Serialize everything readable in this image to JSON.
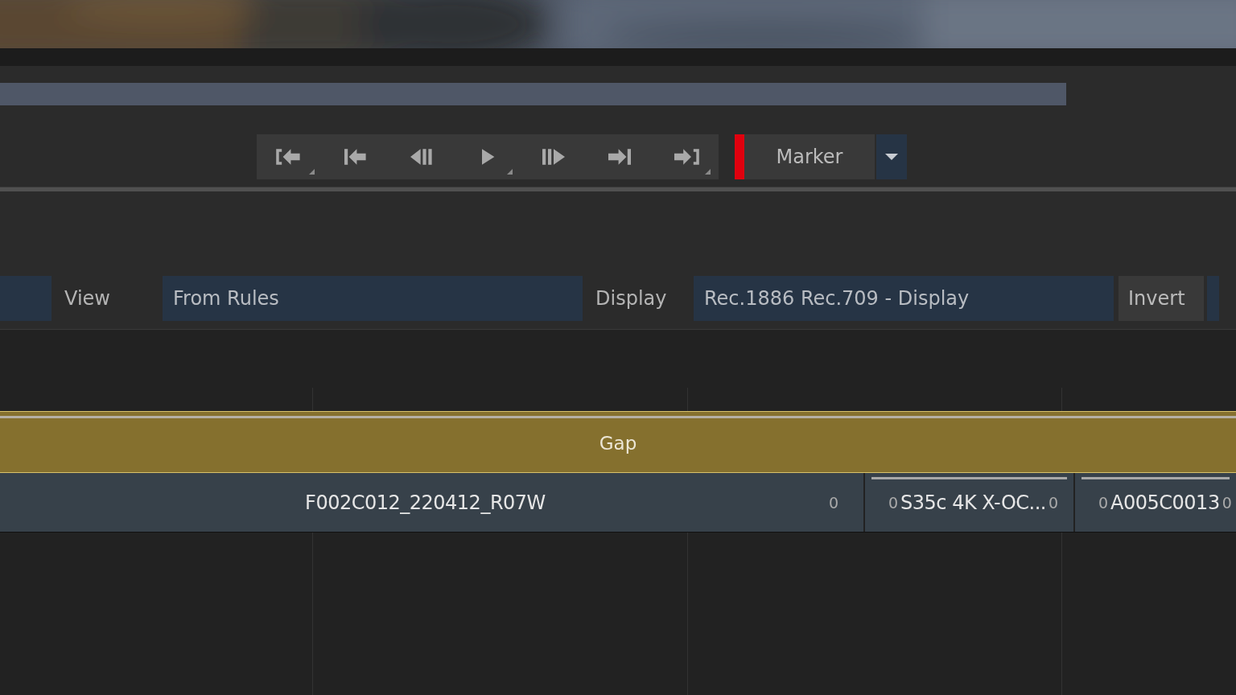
{
  "transport": {
    "buttons": [
      {
        "kind": "in-point",
        "has_menu": true
      },
      {
        "kind": "previous-edit",
        "has_menu": false
      },
      {
        "kind": "step-back",
        "has_menu": false
      },
      {
        "kind": "play",
        "has_menu": true
      },
      {
        "kind": "step-forward",
        "has_menu": false
      },
      {
        "kind": "next-edit",
        "has_menu": false
      },
      {
        "kind": "out-point",
        "has_menu": true
      }
    ]
  },
  "marker": {
    "label": "Marker"
  },
  "color_settings": {
    "view_label": "View",
    "view_value": "From Rules",
    "display_label": "Display",
    "display_value": "Rec.1886 Rec.709 - Display",
    "invert_label": "Invert"
  },
  "timeline": {
    "gap_label": "Gap",
    "clips": [
      {
        "name": "F002C012_220412_R07W",
        "out_frame": "0",
        "has_top_bar": false
      },
      {
        "name": "S35c 4K X-OC...",
        "in_frame": "0",
        "out_frame": "0",
        "has_top_bar": true
      },
      {
        "name": "A005C0013",
        "in_frame": "0",
        "out_frame": "0",
        "has_top_bar": true
      }
    ]
  }
}
